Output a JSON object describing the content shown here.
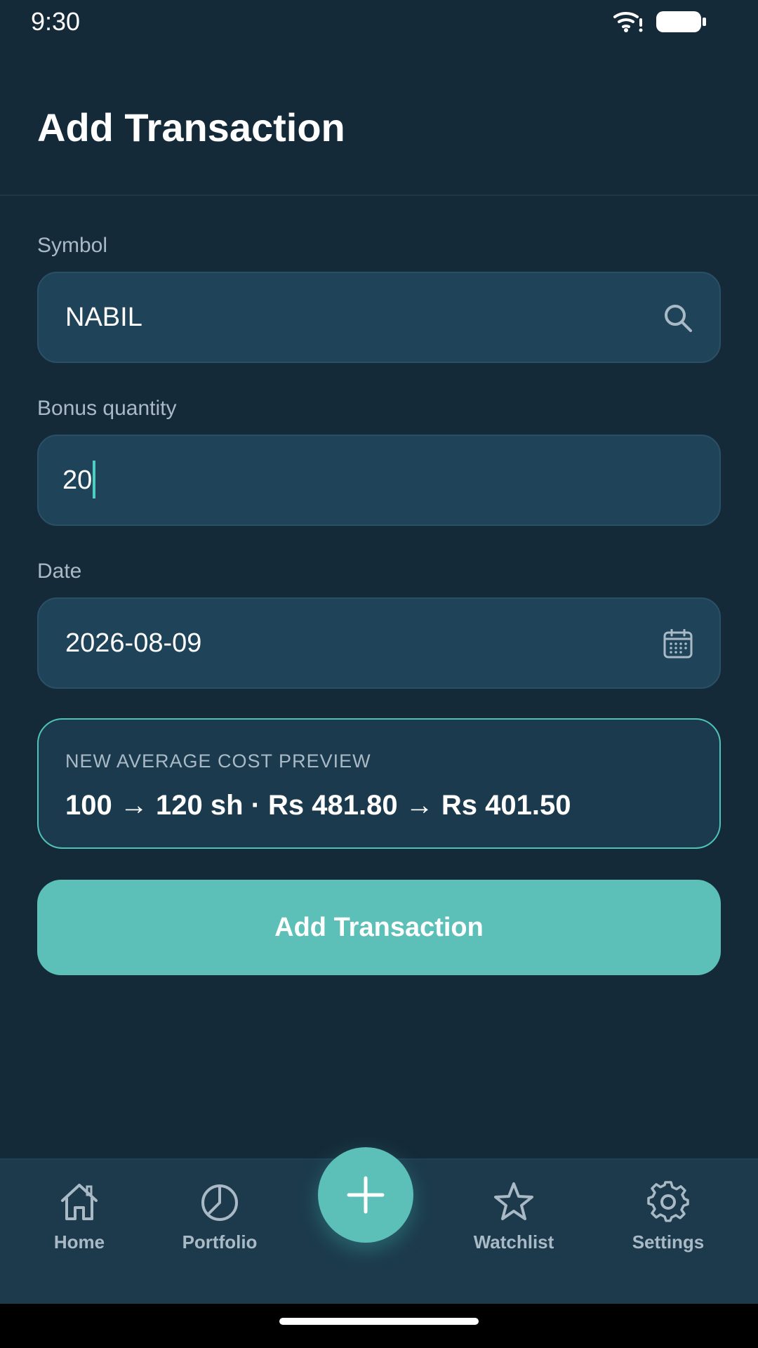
{
  "status_bar": {
    "time": "9:30"
  },
  "header": {
    "title": "Add Transaction"
  },
  "form": {
    "symbol": {
      "label": "Symbol",
      "value": "NABIL",
      "icon": "search-icon"
    },
    "bonus_quantity": {
      "label": "Bonus quantity",
      "value": "20"
    },
    "date": {
      "label": "Date",
      "value": "2026-08-09",
      "icon": "calendar-icon"
    }
  },
  "preview": {
    "label": "NEW AVERAGE COST PREVIEW",
    "value": "100 → 120 sh · Rs 481.80 → Rs 401.50"
  },
  "submit_label": "Add Transaction",
  "bottom_nav": {
    "items": [
      {
        "label": "Home",
        "icon": "home-icon"
      },
      {
        "label": "Portfolio",
        "icon": "pie-chart-icon"
      },
      {
        "label": "Watchlist",
        "icon": "star-icon"
      },
      {
        "label": "Settings",
        "icon": "gear-icon"
      }
    ],
    "fab_icon": "plus-icon"
  },
  "colors": {
    "background": "#152a38",
    "field_background": "#1f4459",
    "accent": "#5cc0b8",
    "muted_text": "#a9bac6"
  }
}
